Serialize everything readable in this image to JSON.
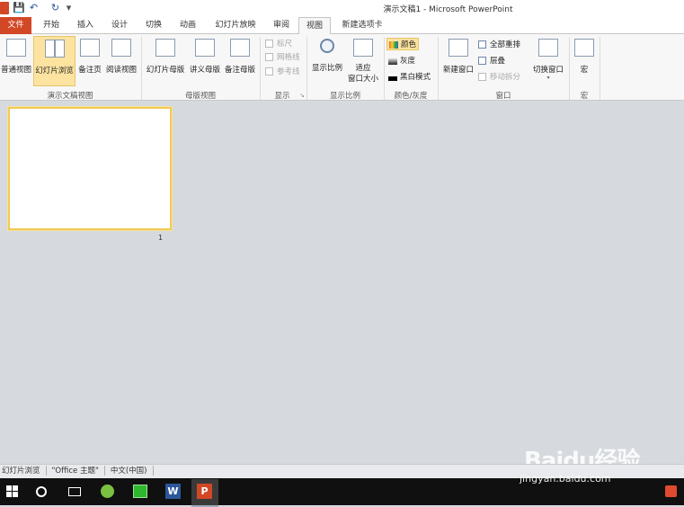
{
  "window": {
    "title": "演示文稿1 - Microsoft PowerPoint"
  },
  "tabs": [
    {
      "label": "文件"
    },
    {
      "label": "开始"
    },
    {
      "label": "插入"
    },
    {
      "label": "设计"
    },
    {
      "label": "切换"
    },
    {
      "label": "动画"
    },
    {
      "label": "幻灯片放映"
    },
    {
      "label": "审阅"
    },
    {
      "label": "视图"
    },
    {
      "label": "新建选项卡"
    }
  ],
  "ribbon": {
    "presentation_views": {
      "label": "演示文稿视图",
      "normal": "普通视图",
      "sorter": "幻灯片浏览",
      "notes": "备注页",
      "reading": "阅读视图"
    },
    "master_views": {
      "label": "母版视图",
      "slide_master": "幻灯片母版",
      "handout_master": "讲义母版",
      "notes_master": "备注母版"
    },
    "show": {
      "label": "显示",
      "ruler": "标尺",
      "gridlines": "网格线",
      "guides": "参考线"
    },
    "zoom": {
      "label": "显示比例",
      "zoom": "显示比例",
      "fit1": "适应",
      "fit2": "窗口大小"
    },
    "color": {
      "label": "颜色/灰度",
      "color": "颜色",
      "grayscale": "灰度",
      "bw": "黑白模式"
    },
    "window": {
      "label": "窗口",
      "new_window": "新建窗口",
      "arrange_all": "全部重排",
      "cascade": "层叠",
      "move_split": "移动拆分",
      "switch": "切换窗口"
    },
    "macros": {
      "label": "宏",
      "macros": "宏"
    }
  },
  "slides": {
    "number": "1"
  },
  "status": {
    "view": "幻灯片浏览",
    "theme": "\"Office 主题\"",
    "language": "中文(中国)"
  },
  "watermark": {
    "logo": "Baidu经验",
    "url": "jingyan.baidu.com"
  },
  "colors": {
    "file_tab": "#d24726",
    "active_button": "#fde3a0",
    "selection_border": "#f2ca54",
    "taskbar": "#101010"
  }
}
